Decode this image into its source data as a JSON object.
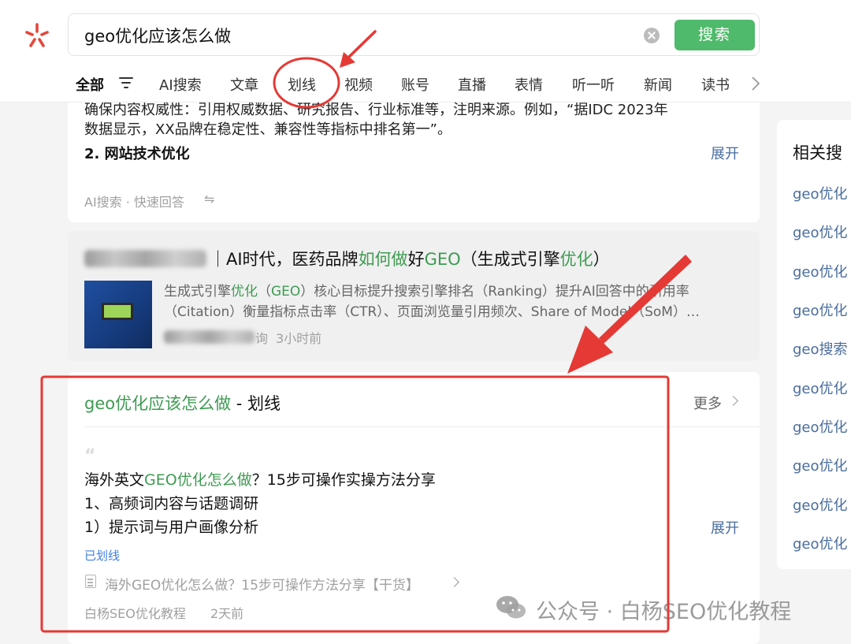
{
  "search": {
    "query": "geo优化应该怎么做",
    "button_label": "搜索"
  },
  "tabs": [
    {
      "label": "全部"
    },
    {
      "label": "AI搜索"
    },
    {
      "label": "文章"
    },
    {
      "label": "划线"
    },
    {
      "label": "视频"
    },
    {
      "label": "账号"
    },
    {
      "label": "直播"
    },
    {
      "label": "表情"
    },
    {
      "label": "听一听"
    },
    {
      "label": "新闻"
    },
    {
      "label": "读书"
    }
  ],
  "ai_card": {
    "line1": "确保内容权威性：引用权威数据、研究报告、行业标准等，注明来源。例如，“据IDC 2023年",
    "line2": "数据显示，XX品牌在稳定性、兼容性等指标中排名第一”。",
    "heading": "2. 网站技术优化",
    "expand": "展开",
    "footer": "AI搜索 · 快速回答",
    "swap_symbol": "⇋"
  },
  "article_card": {
    "title_sep": "｜",
    "title_parts": [
      "AI时代，医药品牌",
      "如何做",
      "好",
      "GEO",
      "（生成式引擎",
      "优化",
      "）"
    ],
    "desc_line1_parts": [
      "生成式引擎",
      "优化",
      "（",
      "GEO",
      "）核心目标提升搜索引擎排名（Ranking）提升AI回答中的引用率"
    ],
    "desc_line2": "（Citation）衡量指标点击率（CTR）、页面浏览量引用频次、Share of Model（SoM）…",
    "source_tail": "询",
    "time": "3小时前"
  },
  "highlight_card": {
    "title_query": "geo优化应该怎么做",
    "title_suffix": " - 划线",
    "more": "更多",
    "quote_mark": "“",
    "line1_parts": [
      "海外英文",
      "GEO优化怎么做",
      "？15步可操作实操方法分享"
    ],
    "line2": "1、高频词内容与话题调研",
    "line3": "1）提示词与用户画像分析",
    "expand": "展开",
    "highlighted_tag": "已划线",
    "source_article": "海外GEO优化怎么做？15步可操作方法分享【干货】",
    "author": "白杨SEO优化教程",
    "time": "2天前"
  },
  "related": {
    "title": "相关搜",
    "items": [
      "geo优化",
      "geo优化",
      "geo优化",
      "geo优化",
      "geo搜索",
      "geo优化",
      "geo优化",
      "geo优化",
      "geo优化",
      "geo优化"
    ]
  },
  "watermark": {
    "text": "公众号 · 白杨SEO优化教程"
  },
  "colors": {
    "accent_green": "#4fba6b",
    "highlight_green": "#3e9b52",
    "annotation_red": "#e53935",
    "expand_blue": "#4a6d9e",
    "tag_blue": "#3d7ee0"
  }
}
